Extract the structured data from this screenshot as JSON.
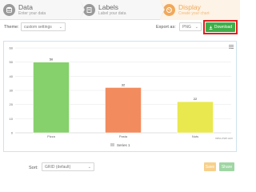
{
  "steps": [
    {
      "title": "Data",
      "subtitle": "Enter your data",
      "icon": "data-icon"
    },
    {
      "title": "Labels",
      "subtitle": "Label your data",
      "icon": "book-icon"
    },
    {
      "title": "Display",
      "subtitle": "Create your chart",
      "icon": "palette-icon",
      "active": true
    }
  ],
  "toolbar": {
    "theme_label": "Theme:",
    "theme_value": "custom settings",
    "export_label": "Export as:",
    "export_value": "PNG",
    "download_label": "Download"
  },
  "chart_data": {
    "type": "bar",
    "categories": [
      "Pizza",
      "Pasta",
      "Nuts"
    ],
    "series": [
      {
        "name": "Series 1",
        "values": [
          50,
          32,
          22
        ],
        "colors": [
          "#86d16b",
          "#f28b5e",
          "#e9e84e"
        ]
      }
    ],
    "ylim": [
      0,
      60
    ],
    "yticks": [
      0,
      10,
      20,
      30,
      40,
      50,
      60
    ],
    "grid": true,
    "legend": "bottom",
    "credits": "meta-chart.com"
  },
  "footer": {
    "sort_label": "Sort:",
    "sort_value": "GRID (default)",
    "save_label": "Save",
    "share_label": "Share"
  },
  "colors": {
    "accent": "#f0a85a",
    "download": "#3fae49",
    "highlight": "#e02020"
  }
}
